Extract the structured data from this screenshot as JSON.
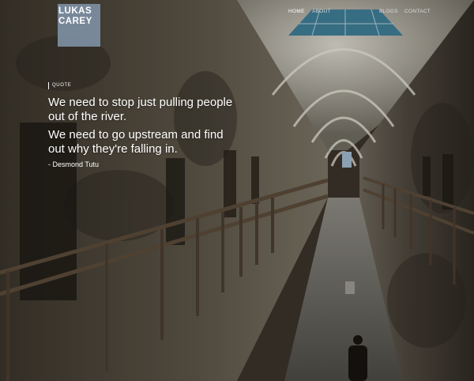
{
  "brand": {
    "line1": "LUKAS",
    "line2": "CAREY"
  },
  "nav": {
    "home": "HOME",
    "about": "ABOUT",
    "blogs": "BLOGS",
    "contact": "CONTACT"
  },
  "quote": {
    "tag": "QUOTE",
    "lines": [
      "We need to stop just pulling people",
      "out of the river.",
      "We need to go upstream and find",
      "out why they're falling in."
    ],
    "author": "- Desmond Tutu"
  },
  "colors": {
    "logo_block": "#7d8fa3",
    "wall": "#4a4033",
    "skylight": "#3f7d96"
  }
}
